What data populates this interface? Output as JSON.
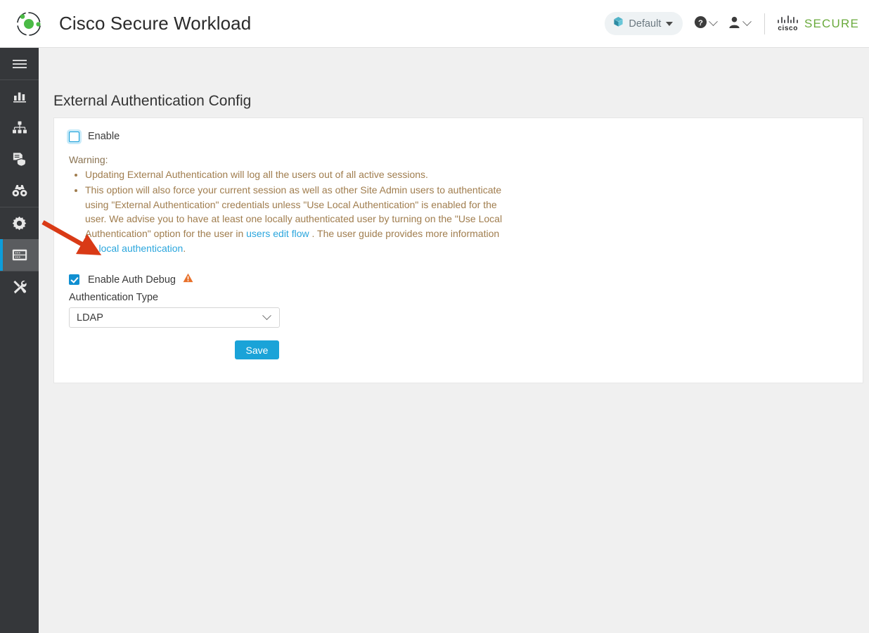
{
  "header": {
    "app_title": "Cisco Secure Workload",
    "logo_icon": "orbit-logo-icon",
    "scope": {
      "label": "Default",
      "icon": "cube-icon",
      "caret_icon": "caret-down-icon"
    },
    "help_icon": "help-circle-icon",
    "help_chevron_icon": "chevron-down-icon",
    "user_icon": "user-silhouette-icon",
    "user_chevron_icon": "chevron-down-icon",
    "cisco_wordmark": "cisco",
    "secure_wordmark": "SECURE",
    "secure_color": "#6aaa3c"
  },
  "sidebar": {
    "items": [
      {
        "name": "menu-toggle",
        "icon": "hamburger-menu-icon",
        "active": false
      },
      {
        "name": "overview",
        "icon": "bar-chart-icon",
        "active": false
      },
      {
        "name": "organize",
        "icon": "hierarchy-cubes-icon",
        "active": false
      },
      {
        "name": "defend",
        "icon": "document-shield-icon",
        "active": false
      },
      {
        "name": "investigate",
        "icon": "binoculars-icon",
        "active": false
      },
      {
        "name": "manage",
        "icon": "gear-icon",
        "active": false
      },
      {
        "name": "platform",
        "icon": "server-rack-icon",
        "active": true
      },
      {
        "name": "tools",
        "icon": "hammer-wrench-icon",
        "active": false
      }
    ],
    "active_indicator_color": "#0d9ddb"
  },
  "main": {
    "page_title": "External Authentication Config",
    "enable": {
      "label": "Enable",
      "checked": false
    },
    "warning": {
      "heading": "Warning:",
      "color": "#a07d4e",
      "bullets": [
        {
          "segments": [
            {
              "type": "text",
              "text": "Updating External Authentication will log all the users out of all active sessions."
            }
          ]
        },
        {
          "segments": [
            {
              "type": "text",
              "text": "This option will also force your current session as well as other Site Admin users to authenticate using \"External Authentication\" credentials unless \"Use Local Authentication\" is enabled for the user. We advise you to have at least one locally authenticated user by turning on the \"Use Local Authentication\" option for the user in "
            },
            {
              "type": "link",
              "text": "users edit flow"
            },
            {
              "type": "text",
              "text": " . The user guide provides more information on "
            },
            {
              "type": "link",
              "text": "local authentication"
            },
            {
              "type": "text",
              "text": "."
            }
          ]
        }
      ],
      "link_color": "#2ba6dd"
    },
    "auth_debug": {
      "label": "Enable Auth Debug",
      "checked": true,
      "warning_icon": "warning-triangle-icon",
      "warning_icon_color": "#e8702a"
    },
    "auth_type": {
      "label": "Authentication Type",
      "value": "LDAP",
      "chevron_icon": "chevron-down-icon"
    },
    "save_button": {
      "label": "Save",
      "color": "#1aa3d8"
    }
  },
  "annotation": {
    "arrow_icon": "red-arrow-annotation",
    "color": "#d93a16"
  }
}
